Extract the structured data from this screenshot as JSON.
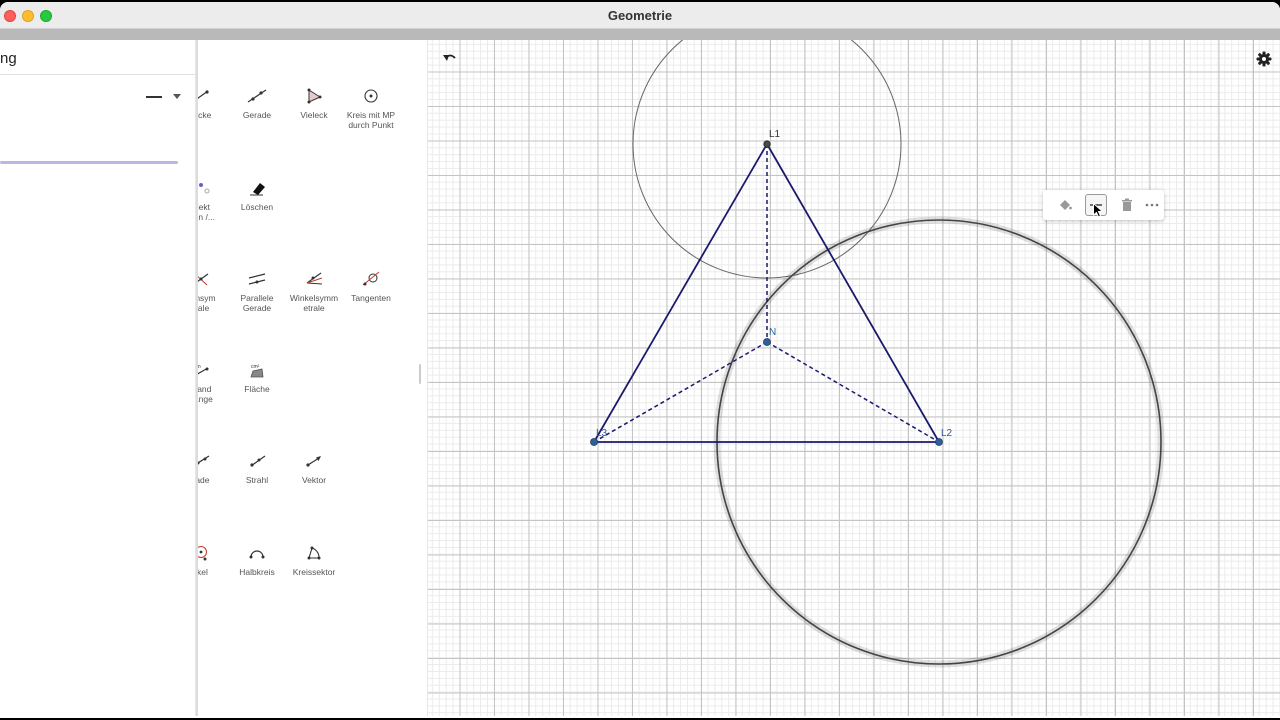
{
  "window": {
    "title": "Geometrie"
  },
  "left_panel": {
    "title": "ng"
  },
  "tools": [
    {
      "label": "recke",
      "icon": "segment-icon"
    },
    {
      "label": "Gerade",
      "icon": "line-icon"
    },
    {
      "label": "Vieleck",
      "icon": "polygon-icon"
    },
    {
      "label": "Kreis mit MP\ndurch Punkt",
      "icon": "circle-center-point-icon"
    },
    {
      "label": "bjekt\nigen /...",
      "icon": "show-hide-object-icon"
    },
    {
      "label": "Löschen",
      "icon": "eraser-icon"
    },
    {
      "label": "kensym\ntrale",
      "icon": "perpendicular-bisector-icon"
    },
    {
      "label": "Parallele\nGerade",
      "icon": "parallel-line-icon"
    },
    {
      "label": "Winkelsymm\netrale",
      "icon": "angle-bisector-icon"
    },
    {
      "label": "Tangenten",
      "icon": "tangents-icon"
    },
    {
      "label": "stand\nLänge",
      "icon": "distance-length-icon"
    },
    {
      "label": "Fläche",
      "icon": "area-icon"
    },
    {
      "label": "rade",
      "icon": "line-partial-icon"
    },
    {
      "label": "Strahl",
      "icon": "ray-icon"
    },
    {
      "label": "Vektor",
      "icon": "vector-icon"
    },
    {
      "label": "rkel",
      "icon": "compass-icon"
    },
    {
      "label": "Halbkreis",
      "icon": "semicircle-icon"
    },
    {
      "label": "Kreissektor",
      "icon": "circle-sector-icon"
    }
  ],
  "canvas": {
    "points": {
      "L1": {
        "label": "L1"
      },
      "L2": {
        "label": "L2"
      },
      "L3": {
        "label": "L3"
      },
      "N": {
        "label": "N"
      }
    }
  },
  "colors": {
    "triangle": "#1a1a6e",
    "point": "#2d5f9a",
    "circle": "#555555",
    "slider": "#b9b8e0"
  }
}
